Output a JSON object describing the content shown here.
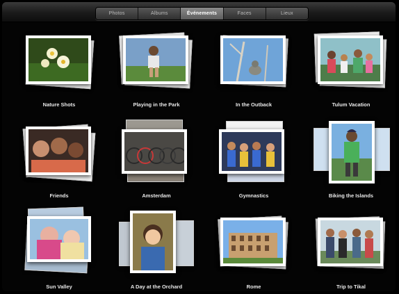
{
  "tabs": [
    {
      "label": "Photos",
      "active": false
    },
    {
      "label": "Albums",
      "active": false
    },
    {
      "label": "Événements",
      "active": true
    },
    {
      "label": "Faces",
      "active": false
    },
    {
      "label": "Lieux",
      "active": false
    }
  ],
  "events": [
    {
      "title": "Nature Shots"
    },
    {
      "title": "Playing in the Park"
    },
    {
      "title": "In the Outback"
    },
    {
      "title": "Tulum Vacation"
    },
    {
      "title": "Friends"
    },
    {
      "title": "Amsterdam"
    },
    {
      "title": "Gymnastics"
    },
    {
      "title": "Biking the Islands"
    },
    {
      "title": "Sun Valley"
    },
    {
      "title": "A Day at the Orchard"
    },
    {
      "title": "Rome"
    },
    {
      "title": "Trip to Tikal"
    }
  ],
  "colors": {
    "background": "#000000",
    "tab_active": "#6e6e6e",
    "label_text": "#e8e8e8"
  }
}
